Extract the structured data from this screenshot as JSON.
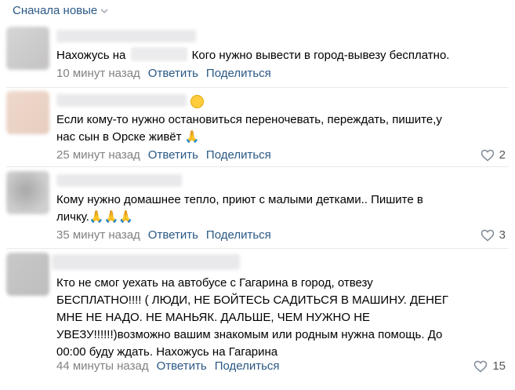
{
  "sort": {
    "label": "Сначала новые",
    "icon": "chevron-down-icon"
  },
  "actions": {
    "reply": "Ответить",
    "share": "Поделиться"
  },
  "colors": {
    "link": "#2a5885",
    "meta": "#828282",
    "divider": "#e7e8ec"
  },
  "comments": [
    {
      "text_before": "Нахожусь на",
      "text_after": "Кого нужно вывести в город-вывезу бесплатно.",
      "time": "10 минут назад",
      "likes": ""
    },
    {
      "line1": "Если кому-то нужно остановиться переночевать, переждать, пишите,у",
      "line2": "нас сын в Орске живёт",
      "time": "25 минут назад",
      "likes": "2"
    },
    {
      "line1": "Кому нужно домашнее тепло, приют с малыми детками.. Пишите в",
      "line2": "личку.",
      "time": "35 минут назад",
      "likes": "3"
    },
    {
      "lines": [
        "Кто не смог уехать на автобусе с Гагарина в город, отвезу",
        "БЕСПЛАТНО!!!! ( ЛЮДИ, НЕ БОЙТЕСЬ САДИТЬСЯ В МАШИНУ. ДЕНЕГ",
        "МНЕ НЕ НАДО. НЕ МАНЬЯК. ДАЛЬШЕ, ЧЕМ НУЖНО НЕ",
        "УВЕЗУ!!!!!!)возможно вашим знакомым или родным нужна помощь. До",
        "00:00 буду ждать. Нахожусь на Гагарина"
      ],
      "time": "44 минуты назад",
      "likes": "15"
    }
  ]
}
